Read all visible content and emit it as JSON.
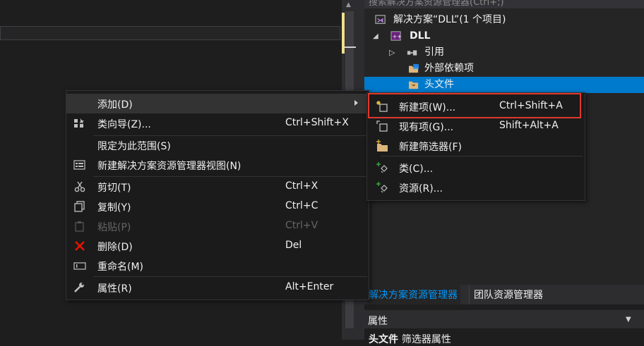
{
  "solution_explorer": {
    "search_placeholder": "搜索解决方案资源管理器(Ctrl+;)",
    "solution_label": "解决方案“DLL”(1 个项目)",
    "project_label": "DLL",
    "references_label": "引用",
    "external_deps_label": "外部依赖项",
    "header_files_label": "头文件"
  },
  "tabs": {
    "solution_explorer": "解决方案资源管理器",
    "team_explorer": "团队资源管理器"
  },
  "properties": {
    "title": "属性",
    "subtitle_bold": "头文件",
    "subtitle_rest": "筛选器属性"
  },
  "context_menu": {
    "add": {
      "label": "添加(D)"
    },
    "class_wizard": {
      "label": "类向导(Z)...",
      "shortcut": "Ctrl+Shift+X"
    },
    "scope_to_this": {
      "label": "限定为此范围(S)"
    },
    "new_se_view": {
      "label": "新建解决方案资源管理器视图(N)"
    },
    "cut": {
      "label": "剪切(T)",
      "shortcut": "Ctrl+X"
    },
    "copy": {
      "label": "复制(Y)",
      "shortcut": "Ctrl+C"
    },
    "paste": {
      "label": "粘贴(P)",
      "shortcut": "Ctrl+V",
      "disabled": true
    },
    "delete": {
      "label": "删除(D)",
      "shortcut": "Del"
    },
    "rename": {
      "label": "重命名(M)"
    },
    "properties": {
      "label": "属性(R)",
      "shortcut": "Alt+Enter"
    }
  },
  "add_submenu": {
    "new_item": {
      "label": "新建项(W)...",
      "shortcut": "Ctrl+Shift+A"
    },
    "existing_item": {
      "label": "现有项(G)...",
      "shortcut": "Shift+Alt+A"
    },
    "new_filter": {
      "label": "新建筛选器(F)"
    },
    "class": {
      "label": "类(C)..."
    },
    "resource": {
      "label": "资源(R)..."
    }
  },
  "colors": {
    "accent": "#007acc",
    "highlight_box": "#e0382c",
    "menu_bg": "#1b1b1c"
  }
}
